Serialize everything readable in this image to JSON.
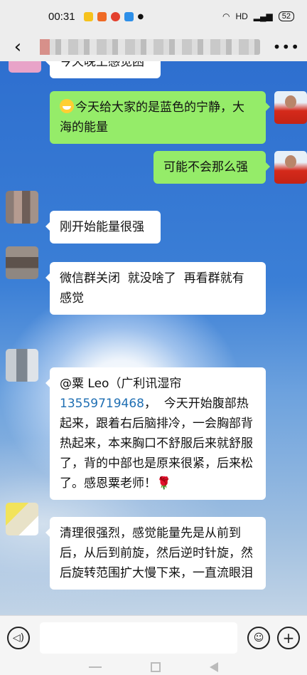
{
  "status_bar": {
    "time": "00:31",
    "network": "HD",
    "battery": "52"
  },
  "title_bar": {
    "back_glyph": "‹",
    "more_glyph": "•••"
  },
  "messages": [
    {
      "side": "in",
      "text": "今天晚上感觉困"
    },
    {
      "side": "out",
      "text": "今天给大家的是蓝色的宁静，大海的能量",
      "emoji": "grinning-face"
    },
    {
      "side": "out",
      "text": "可能不会那么强"
    },
    {
      "side": "in",
      "text": "刚开始能量很强"
    },
    {
      "side": "in",
      "text": "微信群关闭  就没啥了  再看群就有感觉"
    },
    {
      "side": "in",
      "mention": "@粟 Leo（广利讯湿帘",
      "phone": "13559719468",
      "text": "，  今天开始腹部热起来，跟着右后脑排冷，一会胸部背热起来，本来胸口不舒服后来就舒服了，背的中部也是原来很紧，后来松了。感恩粟老师！",
      "emoji": "rose"
    },
    {
      "side": "in",
      "text": "清理很强烈，感觉能量先是从前到后，从后到前旋，然后逆时针旋，然后旋转范围扩大慢下来，一直流眼泪"
    }
  ],
  "input_bar": {
    "voice_icon": "voice-icon",
    "emoji_icon": "smiley-icon",
    "plus_icon": "plus-icon"
  },
  "colors": {
    "outgoing_bubble": "#95ec69",
    "incoming_bubble": "#ffffff",
    "phone_link": "#1f6fb3"
  }
}
